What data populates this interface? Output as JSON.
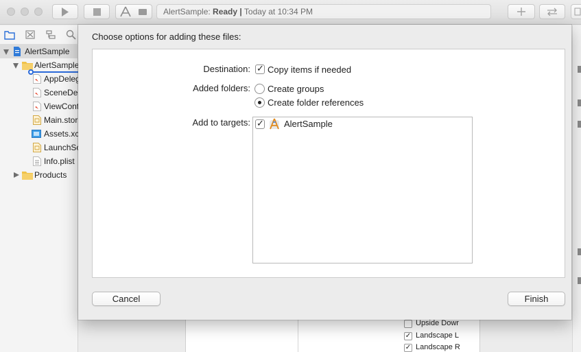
{
  "window": {
    "activity": {
      "project": "AlertSample:",
      "status": "Ready",
      "separator": "|",
      "time": "Today at 10:34 PM"
    }
  },
  "navigator": {
    "items": [
      {
        "label": "AlertSample",
        "icon": "project-file-icon"
      },
      {
        "label": "AlertSample",
        "icon": "folder-icon"
      },
      {
        "label": "AppDeleg",
        "icon": "swift-file-icon"
      },
      {
        "label": "SceneDel",
        "icon": "swift-file-icon"
      },
      {
        "label": "ViewCont",
        "icon": "swift-file-icon"
      },
      {
        "label": "Main.stor",
        "icon": "storyboard-file-icon"
      },
      {
        "label": "Assets.xc",
        "icon": "asset-catalog-icon"
      },
      {
        "label": "LaunchSc",
        "icon": "storyboard-file-icon"
      },
      {
        "label": "Info.plist",
        "icon": "plist-file-icon"
      },
      {
        "label": "Products",
        "icon": "folder-icon"
      }
    ]
  },
  "inspector": {
    "orientations": [
      {
        "label": "Upside Dowr",
        "checked": false
      },
      {
        "label": "Landscape L",
        "checked": true
      },
      {
        "label": "Landscape R",
        "checked": true
      }
    ]
  },
  "sheet": {
    "title": "Choose options for adding these files:",
    "destination": {
      "label": "Destination:",
      "option": "Copy items if needed",
      "checked": true
    },
    "added_folders": {
      "label": "Added folders:",
      "options": [
        {
          "label": "Create groups",
          "selected": false
        },
        {
          "label": "Create folder references",
          "selected": true
        }
      ]
    },
    "targets": {
      "label": "Add to targets:",
      "items": [
        {
          "label": "AlertSample",
          "checked": true,
          "icon": "app-target-icon"
        }
      ]
    },
    "buttons": {
      "cancel": "Cancel",
      "finish": "Finish"
    }
  }
}
